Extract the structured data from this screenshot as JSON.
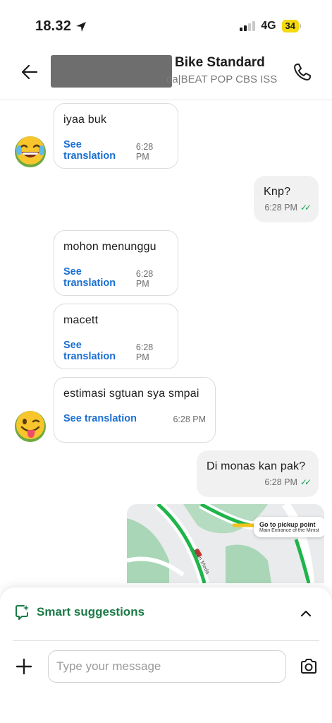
{
  "status_bar": {
    "time": "18.32",
    "network": "4G",
    "battery": "34"
  },
  "header": {
    "title": "Bike Standard",
    "subtitle": "da|BEAT POP CBS ISS"
  },
  "messages": [
    {
      "direction": "incoming",
      "text": "iyaa buk",
      "translate_label": "See translation",
      "time": "6:28 PM"
    },
    {
      "direction": "outgoing",
      "text": "Knp?",
      "time": "6:28 PM"
    },
    {
      "direction": "incoming",
      "text": "mohon menunggu",
      "translate_label": "See translation",
      "time": "6:28 PM"
    },
    {
      "direction": "incoming",
      "text": "macett",
      "translate_label": "See translation",
      "time": "6:28 PM"
    },
    {
      "direction": "incoming",
      "text": "estimasi sgtuan sya smpai",
      "translate_label": "See translation",
      "time": "6:28 PM"
    },
    {
      "direction": "outgoing",
      "text": "Di monas kan pak?",
      "time": "6:28 PM"
    }
  ],
  "map": {
    "card_title": "Go to pickup point",
    "card_subtitle": "Main Entrance of the Minist",
    "road_label": "Jalan Meda"
  },
  "smart_suggestions": {
    "label": "Smart suggestions"
  },
  "composer": {
    "placeholder": "Type your message"
  },
  "icons": {
    "back": "arrow-left-icon",
    "call": "phone-icon",
    "sparkle": "smart-suggestions-icon",
    "collapse": "chevron-up-icon",
    "add": "plus-icon",
    "camera": "camera-icon",
    "location": "location-arrow-icon",
    "emoji_1": "laughing-tears-emoji",
    "emoji_2": "winking-tongue-emoji"
  },
  "colors": {
    "link_blue": "#1a6fd1",
    "brand_green": "#1b7a47",
    "read_check": "#1aa35a",
    "battery_yellow": "#f5d90a"
  }
}
